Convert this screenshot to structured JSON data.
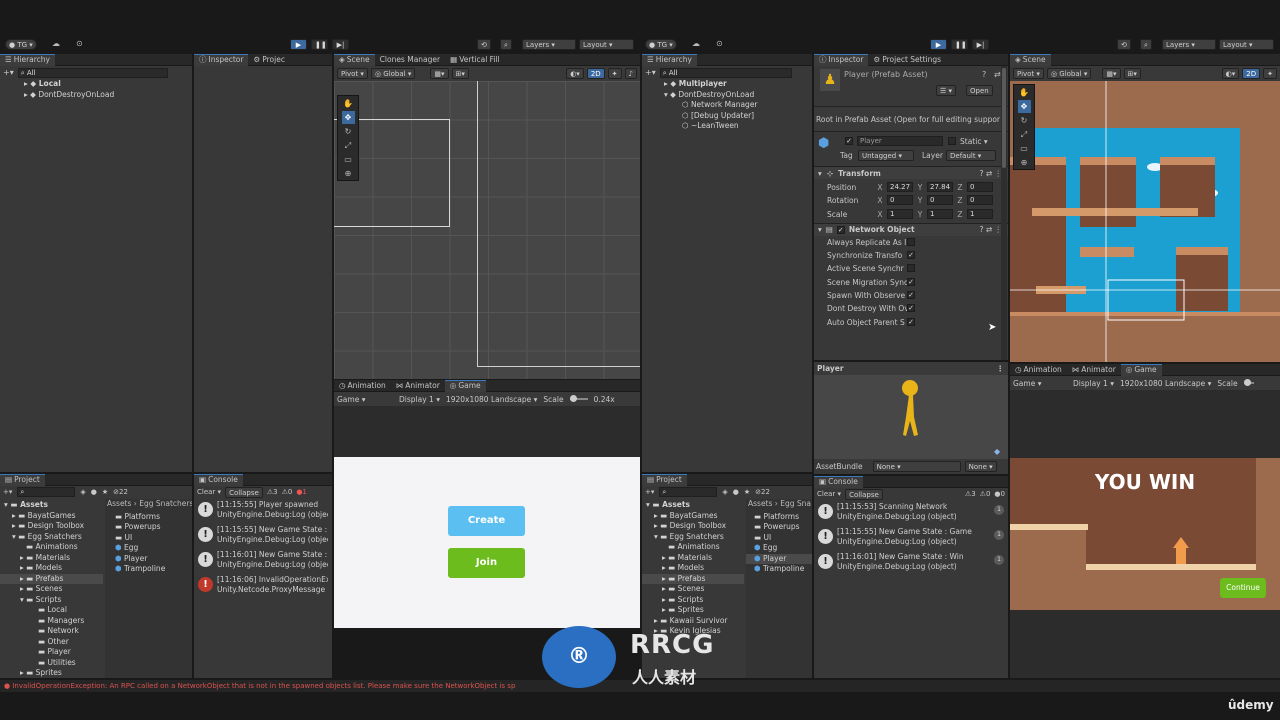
{
  "left": {
    "toolbar": {
      "account": "TG",
      "layers": "Layers",
      "layout": "Layout"
    },
    "hierarchy": {
      "tab": "Hierarchy",
      "search": "All",
      "rows": [
        "Local",
        "DontDestroyOnLoad"
      ]
    },
    "inspector_tabs": [
      "Inspector",
      "Projec"
    ],
    "scene": {
      "tabs": [
        "Scene",
        "Clones Manager",
        "Vertical Fill"
      ],
      "pivot": "Pivot",
      "global": "Global",
      "two_d": "2D"
    },
    "game": {
      "tabs": [
        "Animation",
        "Animator",
        "Game"
      ],
      "mode": "Game",
      "display": "Display 1",
      "resolution": "1920x1080 Landscape",
      "scale_label": "Scale",
      "scale_value": "0.24x",
      "create": "Create",
      "join": "Join"
    },
    "project": {
      "tab": "Project",
      "count": "22",
      "breadcrumb": [
        "Assets",
        "Egg Snatchers"
      ],
      "tree": [
        "Assets",
        "BayatGames",
        "Design Toolbox",
        "Egg Snatchers",
        "Animations",
        "Materials",
        "Models",
        "Prefabs",
        "Scenes",
        "Scripts",
        "Local",
        "Managers",
        "Network",
        "Other",
        "Player",
        "Utilities",
        "Sprites"
      ],
      "files": [
        "Platforms",
        "Powerups",
        "UI",
        "Egg",
        "Player",
        "Trampoline"
      ]
    },
    "console": {
      "tab": "Console",
      "clear": "Clear",
      "collapse": "Collapse",
      "warn_count": "3",
      "info_count": "0",
      "err_count": "1",
      "rows": [
        {
          "l1": "[11:15:55] Player spawned",
          "l2": "UnityEngine.Debug:Log (object)",
          "kind": "warn"
        },
        {
          "l1": "[11:15:55] New Game State : G",
          "l2": "UnityEngine.Debug:Log (object)",
          "kind": "warn"
        },
        {
          "l1": "[11:16:01] New Game State : L",
          "l2": "UnityEngine.Debug:Log (object)",
          "kind": "warn"
        },
        {
          "l1": "[11:16:06] InvalidOperationExc",
          "l2": "Unity.Netcode.ProxyMessage",
          "kind": "err"
        }
      ]
    },
    "status_error": "InvalidOperationException: An RPC called on a NetworkObject that is not in the spawned objects list. Please make sure the NetworkObject is sp"
  },
  "right": {
    "toolbar": {
      "account": "TG",
      "layers": "Layers",
      "layout": "Layout"
    },
    "hierarchy": {
      "tab": "Hierarchy",
      "search": "All",
      "rows": [
        "Multiplayer",
        "DontDestroyOnLoad",
        "Network Manager",
        "[Debug Updater]",
        "~LeanTween"
      ]
    },
    "inspector": {
      "tabs": [
        "Inspector",
        "Project Settings"
      ],
      "title": "Player (Prefab Asset)",
      "open": "Open",
      "root_note": "Root in Prefab Asset (Open for full editing suppor",
      "name": "Player",
      "static": "Static",
      "tag_label": "Tag",
      "tag": "Untagged",
      "layer_label": "Layer",
      "layer": "Default",
      "transform": {
        "title": "Transform",
        "rows": [
          {
            "label": "Position",
            "x": "24.27",
            "y": "27.84",
            "z": "0"
          },
          {
            "label": "Rotation",
            "x": "0",
            "y": "0",
            "z": "0"
          },
          {
            "label": "Scale",
            "x": "1",
            "y": "1",
            "z": "1"
          }
        ]
      },
      "network_object": {
        "title": "Network Object",
        "rows": [
          {
            "label": "Always Replicate As I",
            "checked": false
          },
          {
            "label": "Synchronize Transfo",
            "checked": true
          },
          {
            "label": "Active Scene Synchr",
            "checked": false
          },
          {
            "label": "Scene Migration Sync",
            "checked": true
          },
          {
            "label": "Spawn With Observe",
            "checked": true
          },
          {
            "label": "Dont Destroy With Ov",
            "checked": true
          },
          {
            "label": "Auto Object Parent S",
            "checked": true
          }
        ]
      },
      "preview_title": "Player",
      "assetbundle_label": "AssetBundle",
      "assetbundle": "None",
      "variant": "None"
    },
    "console": {
      "tab": "Console",
      "clear": "Clear",
      "collapse": "Collapse",
      "warn_count": "3",
      "info_count": "0",
      "err_count": "0",
      "rows": [
        {
          "l1": "[11:15:53] Scanning Network",
          "l2": "UnityEngine.Debug:Log (object)",
          "n": "1"
        },
        {
          "l1": "[11:15:55] New Game State : Game",
          "l2": "UnityEngine.Debug:Log (object)",
          "n": "1"
        },
        {
          "l1": "[11:16:01] New Game State : Win",
          "l2": "UnityEngine.Debug:Log (object)",
          "n": "1"
        }
      ]
    },
    "project": {
      "tab": "Project",
      "count": "22",
      "breadcrumb": [
        "Assets",
        "Egg Sna"
      ],
      "tree": [
        "Assets",
        "BayatGames",
        "Design Toolbox",
        "Egg Snatchers",
        "Animations",
        "Materials",
        "Models",
        "Prefabs",
        "Scenes",
        "Scripts",
        "Sprites",
        "Kawaii Survivor",
        "Kevin Iglesias"
      ],
      "files": [
        "Platforms",
        "Powerups",
        "UI",
        "Egg",
        "Player",
        "Trampoline"
      ]
    },
    "scene": {
      "tab": "Scene",
      "pivot": "Pivot",
      "global": "Global",
      "two_d": "2D"
    },
    "game": {
      "tabs": [
        "Animation",
        "Animator",
        "Game"
      ],
      "mode": "Game",
      "display": "Display 1",
      "resolution": "1920x1080 Landscape",
      "scale_label": "Scale",
      "win_text": "YOU WIN",
      "continue": "Continue"
    }
  },
  "watermark": {
    "brand": "RRCG",
    "sub": "人人素材",
    "udemy": "ûdemy"
  }
}
